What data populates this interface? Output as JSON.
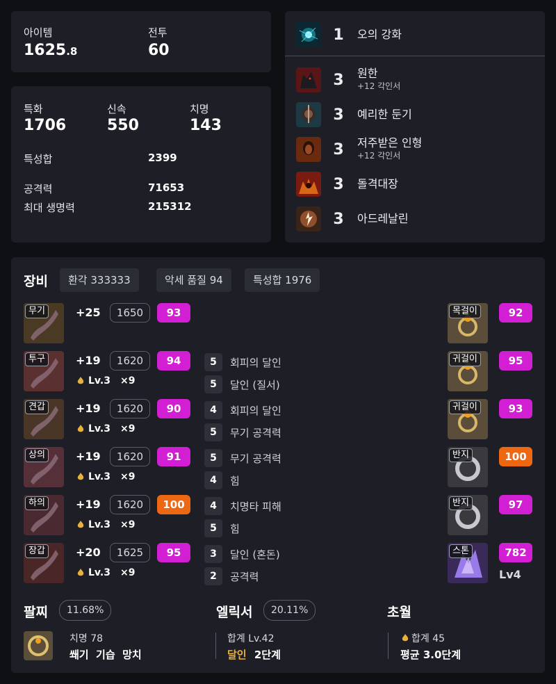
{
  "summary": {
    "item_label": "아이템",
    "item_value_main": "1625",
    "item_value_dec": ".8",
    "combat_label": "전투",
    "combat_value": "60"
  },
  "stats": {
    "crit_spec_label": "특화",
    "crit_spec_value": "1706",
    "swift_label": "신속",
    "swift_value": "550",
    "crit_label": "치명",
    "crit_value": "143",
    "stat_sum_label": "특성합",
    "stat_sum_value": "2399",
    "attack_label": "공격력",
    "attack_value": "71653",
    "hp_label": "최대 생명력",
    "hp_value": "215312"
  },
  "engravings": [
    {
      "level": "1",
      "name": "오의 강화",
      "sub": "",
      "icon": "orb-icon"
    },
    {
      "level": "3",
      "name": "원한",
      "sub": "+12 각인서",
      "icon": "wolf-icon"
    },
    {
      "level": "3",
      "name": "예리한 둔기",
      "sub": "",
      "icon": "mace-icon"
    },
    {
      "level": "3",
      "name": "저주받은 인형",
      "sub": "+12 각인서",
      "icon": "doll-icon"
    },
    {
      "level": "3",
      "name": "돌격대장",
      "sub": "",
      "icon": "charge-icon"
    },
    {
      "level": "3",
      "name": "아드레날린",
      "sub": "",
      "icon": "adrenaline-icon"
    }
  ],
  "equipment": {
    "title": "장비",
    "chips": [
      "환각 333333",
      "악세 품질 94",
      "특성합 1976"
    ],
    "gear": [
      {
        "slot": "무기",
        "plus": "+25",
        "ilvl": "1650",
        "quality": "93",
        "qcolor": "pink",
        "lv": "",
        "count": "",
        "eng": []
      },
      {
        "slot": "투구",
        "plus": "+19",
        "ilvl": "1620",
        "quality": "94",
        "qcolor": "pink",
        "lv": "Lv.3",
        "count": "×9",
        "eng": [
          {
            "n": "5",
            "t": "회피의 달인"
          },
          {
            "n": "5",
            "t": "달인 (질서)"
          }
        ]
      },
      {
        "slot": "견갑",
        "plus": "+19",
        "ilvl": "1620",
        "quality": "90",
        "qcolor": "pink",
        "lv": "Lv.3",
        "count": "×9",
        "eng": [
          {
            "n": "4",
            "t": "회피의 달인"
          },
          {
            "n": "5",
            "t": "무기 공격력"
          }
        ]
      },
      {
        "slot": "상의",
        "plus": "+19",
        "ilvl": "1620",
        "quality": "91",
        "qcolor": "pink",
        "lv": "Lv.3",
        "count": "×9",
        "eng": [
          {
            "n": "5",
            "t": "무기 공격력"
          },
          {
            "n": "4",
            "t": "힘"
          }
        ]
      },
      {
        "slot": "하의",
        "plus": "+19",
        "ilvl": "1620",
        "quality": "100",
        "qcolor": "orange",
        "lv": "Lv.3",
        "count": "×9",
        "eng": [
          {
            "n": "4",
            "t": "치명타 피해"
          },
          {
            "n": "5",
            "t": "힘"
          }
        ]
      },
      {
        "slot": "장갑",
        "plus": "+20",
        "ilvl": "1625",
        "quality": "95",
        "qcolor": "pink",
        "lv": "Lv.3",
        "count": "×9",
        "eng": [
          {
            "n": "3",
            "t": "달인 (혼돈)"
          },
          {
            "n": "2",
            "t": "공격력"
          }
        ]
      }
    ],
    "accessories": [
      {
        "slot": "목걸이",
        "quality": "92",
        "qcolor": "pink",
        "extra": ""
      },
      {
        "slot": "귀걸이",
        "quality": "95",
        "qcolor": "pink",
        "extra": ""
      },
      {
        "slot": "귀걸이",
        "quality": "93",
        "qcolor": "pink",
        "extra": ""
      },
      {
        "slot": "반지",
        "quality": "100",
        "qcolor": "orange",
        "extra": ""
      },
      {
        "slot": "반지",
        "quality": "97",
        "qcolor": "pink",
        "extra": ""
      },
      {
        "slot": "스톤",
        "quality": "782",
        "qcolor": "pink",
        "extra": "Lv4"
      }
    ]
  },
  "bracelet": {
    "title": "팔찌",
    "percent": "11.68%",
    "line1": "치명 78",
    "line2": "쐐기  기습  망치"
  },
  "elixir": {
    "title": "엘릭서",
    "percent": "20.11%",
    "line1": "합계 Lv.42",
    "line2_accent": "달인",
    "line2_rest": "2단계"
  },
  "transcend": {
    "title": "초월",
    "line1": "합계 45",
    "line2": "평균 3.0단계"
  },
  "colors": {
    "bg": "#0f1014",
    "card": "#1e1f26",
    "quality_pink": "#d31fd3",
    "quality_orange": "#ee6814",
    "accent_gold": "#e8b13a"
  }
}
